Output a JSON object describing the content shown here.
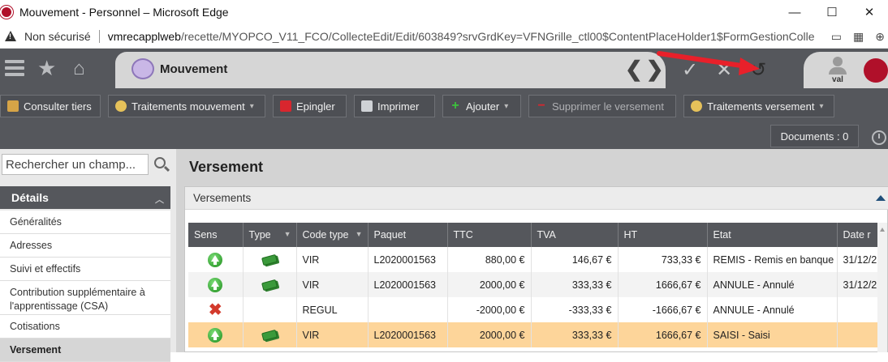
{
  "window": {
    "title": "Mouvement - Personnel – Microsoft Edge",
    "minimize": "—",
    "maximize": "☐",
    "close": "✕"
  },
  "address": {
    "security": "Non sécurisé",
    "url_host": "vmrecapplweb",
    "url_path": "/recette/MYOPCO_V11_FCO/CollecteEdit/Edit/603849?srvGrdKey=VFNGrille_ctl00$ContentPlaceHolder1$FormGestionColle…",
    "icons": [
      "tabs-icon",
      "qr-icon",
      "zoom-icon"
    ]
  },
  "header": {
    "title": "Mouvement",
    "nav_prev": "❮",
    "nav_next": "❯",
    "user_name": "val"
  },
  "toolbar": {
    "buttons": [
      {
        "label": "Consulter tiers",
        "icon": "tools-icon"
      },
      {
        "label": "Traitements mouvement",
        "icon": "money-bag-icon"
      },
      {
        "label": "Epingler",
        "icon": "pin-icon"
      },
      {
        "label": "Imprimer",
        "icon": "printer-icon"
      },
      {
        "label": "Ajouter",
        "icon": "plus-icon"
      },
      {
        "label": "Supprimer le versement",
        "icon": "minus-icon"
      },
      {
        "label": "Traitements versement",
        "icon": "money-bag-icon"
      }
    ],
    "documents": "Documents : 0"
  },
  "sidebar": {
    "search_placeholder": "Rechercher un champ...",
    "section": "Détails",
    "items": [
      "Généralités",
      "Adresses",
      "Suivi et effectifs",
      "Contribution supplémentaire à l'apprentissage (CSA)",
      "Cotisations",
      "Versement"
    ]
  },
  "main": {
    "title": "Versement",
    "panel_title": "Versements",
    "columns": [
      "Sens",
      "Type",
      "Code type",
      "Paquet",
      "TTC",
      "TVA",
      "HT",
      "Etat",
      "Date r"
    ],
    "rows": [
      {
        "sens": "up",
        "type": "money",
        "code": "VIR",
        "paquet": "L2020001563",
        "ttc": "880,00 €",
        "tva": "146,67 €",
        "ht": "733,33 €",
        "etat": "REMIS - Remis en banque",
        "date": "31/12/2"
      },
      {
        "sens": "up",
        "type": "money",
        "code": "VIR",
        "paquet": "L2020001563",
        "ttc": "2000,00 €",
        "tva": "333,33 €",
        "ht": "1666,67 €",
        "etat": "ANNULE - Annulé",
        "date": "31/12/2"
      },
      {
        "sens": "cross",
        "type": "",
        "code": "REGUL",
        "paquet": "",
        "ttc": "-2000,00 €",
        "tva": "-333,33 €",
        "ht": "-1666,67 €",
        "etat": "ANNULE - Annulé",
        "date": ""
      },
      {
        "sens": "up",
        "type": "money",
        "code": "VIR",
        "paquet": "L2020001563",
        "ttc": "2000,00 €",
        "tva": "333,33 €",
        "ht": "1666,67 €",
        "etat": "SAISI - Saisi",
        "date": ""
      }
    ],
    "selected_row": 3
  },
  "colors": {
    "header_bg": "#55575c",
    "tab_bg": "#d6d6d6",
    "selected_row": "#fdd59a",
    "annotation_arrow": "#e8202a"
  }
}
